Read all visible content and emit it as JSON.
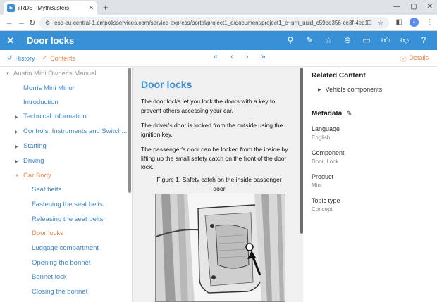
{
  "browser": {
    "tab_title": "iiRDS - MythBusters",
    "tab_favicon": "E",
    "new_tab": "+",
    "url": "esc-eu-central-1.empolisservices.com/service-express/portal/project1_e/document/project1_e~urn_uuid_c59be356-ce3f-4ed1-98f5-414...",
    "avatar": "•"
  },
  "header": {
    "title": "Door locks"
  },
  "subbar": {
    "history_label": "History",
    "contents_label": "Contents",
    "details_label": "Details"
  },
  "toc": {
    "items": [
      {
        "label": "Austin Mini Owner's Manual"
      },
      {
        "label": "Morris Mini Minor"
      },
      {
        "label": "Introduction"
      },
      {
        "label": "Technical Information"
      },
      {
        "label": "Controls, Instruments and Switch..."
      },
      {
        "label": "Starting"
      },
      {
        "label": "Driving"
      },
      {
        "label": "Car Body"
      },
      {
        "label": "Seat belts"
      },
      {
        "label": "Fastening the seat belts"
      },
      {
        "label": "Releasing the seat belts"
      },
      {
        "label": "Door locks"
      },
      {
        "label": "Luggage compartment"
      },
      {
        "label": "Opening the bonnet"
      },
      {
        "label": "Bonnet lock"
      },
      {
        "label": "Closing the bonnet"
      }
    ]
  },
  "document": {
    "title": "Door locks",
    "paragraphs": [
      "The door locks let you lock the doors with a key to prevent others accessing your car.",
      "The driver's door is locked from the outside using the ignition key.",
      "The passenger's door can be locked from the inside by lifting up the small safety catch on the front of the door lock."
    ],
    "figure_caption": "Figure 1. Safety catch on the inside passenger door"
  },
  "right_panel": {
    "related_heading": "Related Content",
    "related_link": "Vehicle components",
    "metadata_heading": "Metadata",
    "metadata": [
      {
        "label": "Language",
        "value": "English"
      },
      {
        "label": "Component",
        "value": "Door, Lock"
      },
      {
        "label": "Product",
        "value": "Mini"
      },
      {
        "label": "Topic type",
        "value": "Concept"
      }
    ]
  },
  "colors": {
    "accent": "#3891d6",
    "active": "#e8864d"
  }
}
